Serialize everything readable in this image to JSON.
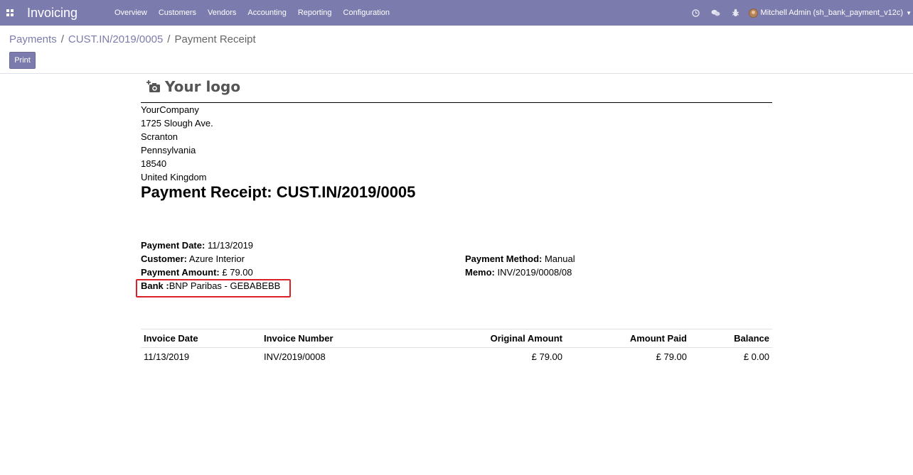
{
  "app": {
    "brand": "Invoicing",
    "menu": [
      "Overview",
      "Customers",
      "Vendors",
      "Accounting",
      "Reporting",
      "Configuration"
    ],
    "user": "Mitchell Admin (sh_bank_payment_v12c)"
  },
  "breadcrumb": {
    "items": [
      "Payments",
      "CUST.IN/2019/0005"
    ],
    "active": "Payment Receipt",
    "separator": "/"
  },
  "toolbar": {
    "print_label": "Print"
  },
  "report": {
    "logo_text": "Your logo",
    "company_lines": [
      "YourCompany",
      "1725 Slough Ave.",
      "Scranton",
      "Pennsylvania",
      "18540",
      "United Kingdom"
    ],
    "title": "Payment Receipt: CUST.IN/2019/0005",
    "fields": {
      "payment_date": {
        "label": "Payment Date:",
        "value": "11/13/2019"
      },
      "customer": {
        "label": "Customer:",
        "value": "Azure Interior"
      },
      "payment_amount": {
        "label": "Payment Amount:",
        "value": "£ 79.00"
      },
      "bank": {
        "label": "Bank :",
        "value": "BNP Paribas - GEBABEBB"
      },
      "payment_method": {
        "label": "Payment Method:",
        "value": "Manual"
      },
      "memo": {
        "label": "Memo:",
        "value": "INV/2019/0008/08"
      }
    },
    "table": {
      "headers": [
        "Invoice Date",
        "Invoice Number",
        "Original Amount",
        "Amount Paid",
        "Balance"
      ],
      "rows": [
        [
          "11/13/2019",
          "INV/2019/0008",
          "£ 79.00",
          "£ 79.00",
          "£ 0.00"
        ]
      ]
    }
  },
  "colors": {
    "navbar": "#7c7bad",
    "highlight_box": "#d9212b"
  },
  "icons": [
    "apps-grid-icon",
    "clock-icon",
    "chat-icon",
    "bug-icon",
    "camera-plus-icon",
    "caret-down-icon"
  ]
}
